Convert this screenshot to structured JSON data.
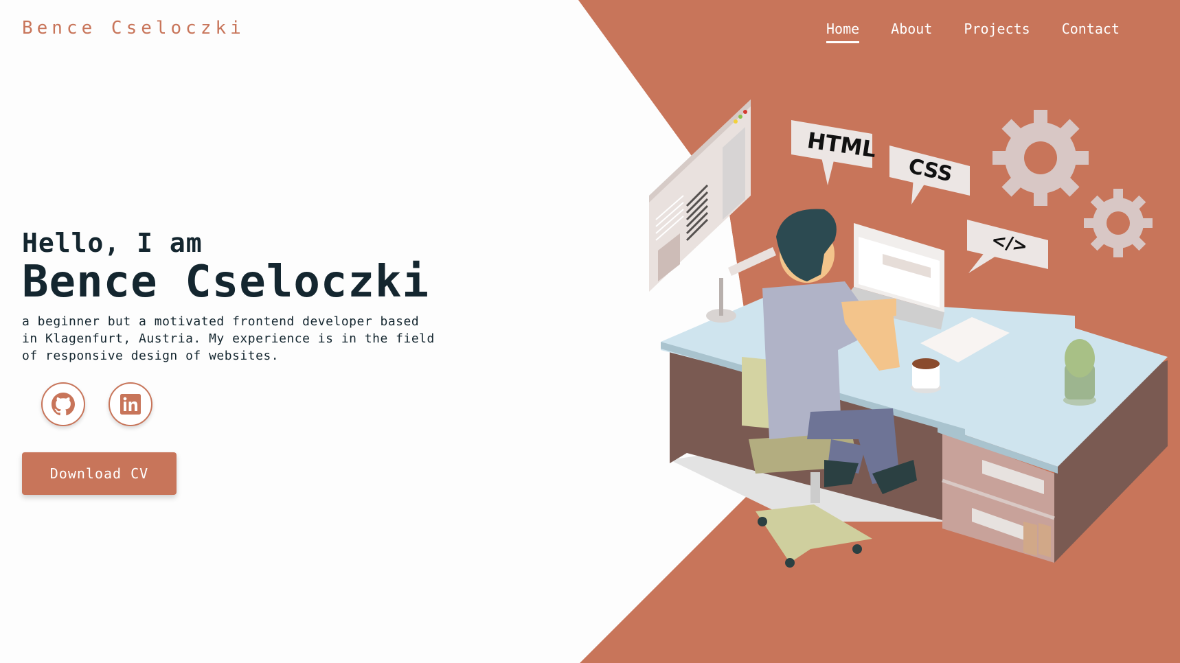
{
  "brand": {
    "name": "Bence Cseloczki"
  },
  "nav": {
    "items": [
      {
        "label": "Home",
        "active": true
      },
      {
        "label": "About",
        "active": false
      },
      {
        "label": "Projects",
        "active": false
      },
      {
        "label": "Contact",
        "active": false
      }
    ]
  },
  "hero": {
    "greeting": "Hello, I am",
    "name": "Bence Cseloczki",
    "tagline": "a beginner but a motivated frontend developer based in Klagenfurt, Austria. My experience is in the field of responsive design of websites."
  },
  "socials": [
    {
      "icon": "github-icon"
    },
    {
      "icon": "linkedin-icon"
    }
  ],
  "cta": {
    "label": "Download CV"
  },
  "illustration": {
    "bubbles": [
      "HTML",
      "CSS",
      "</>"
    ]
  },
  "colors": {
    "accent": "#c8755a",
    "dark_text": "#14262f",
    "background": "#fdfdfd"
  }
}
